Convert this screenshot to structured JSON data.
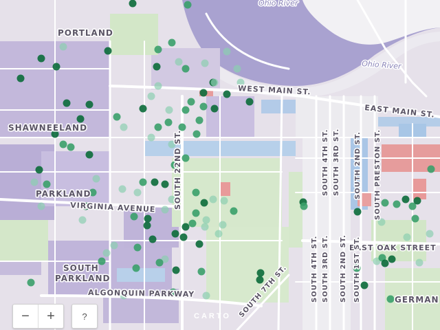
{
  "map": {
    "colors": {
      "land": "#e6e1ea",
      "water": "#a8a1cf",
      "river_bank_light": "#ececf0",
      "road": "#ffffff",
      "parcel_purple": "#b9aed6",
      "parcel_green": "#cfe6c4",
      "parcel_blue": "#a8c8e6",
      "parcel_red": "#e89a9a",
      "point_dark": "#0b6b3a",
      "point_mid": "#3aa06a",
      "point_light": "#8ccfb0"
    },
    "labels": {
      "portland": "PORTLAND",
      "shawneeland": "SHAWNEELAND",
      "parkland": "PARKLAND",
      "south_parkland_1": "SOUTH",
      "south_parkland_2": "PARKLAND",
      "virginia_avenue": "VIRGINIA AVENUE",
      "algonquin_parkway": "ALGONQUIN PARKWAY",
      "south_22nd": "SOUTH 22ND ST.",
      "west_main": "WEST MAIN ST.",
      "east_main": "EAST MAIN ST.",
      "east_oak": "EAST OAK STREET",
      "south_4th_top": "SOUTH 4TH ST.",
      "south_3rd_top": "SOUTH 3RD ST.",
      "south_2nd_top": "SOUTH 2ND ST.",
      "south_preston": "SOUTH PRESTON ST.",
      "south_4th_bottom": "SOUTH 4TH ST.",
      "south_3rd_bottom": "SOUTH 3RD ST.",
      "south_2nd_bottom": "SOUTH 2ND ST.",
      "south_1st": "SOUTH 1ST ST.",
      "south_7th": "SOUTH 7TH ST.",
      "germantown": "GERMAN",
      "ohio_river_1": "Ohio River",
      "ohio_river_2": "Ohio River"
    },
    "attribution": "CARTO",
    "controls": {
      "zoom_out": "−",
      "zoom_in": "+",
      "help": "?"
    }
  }
}
